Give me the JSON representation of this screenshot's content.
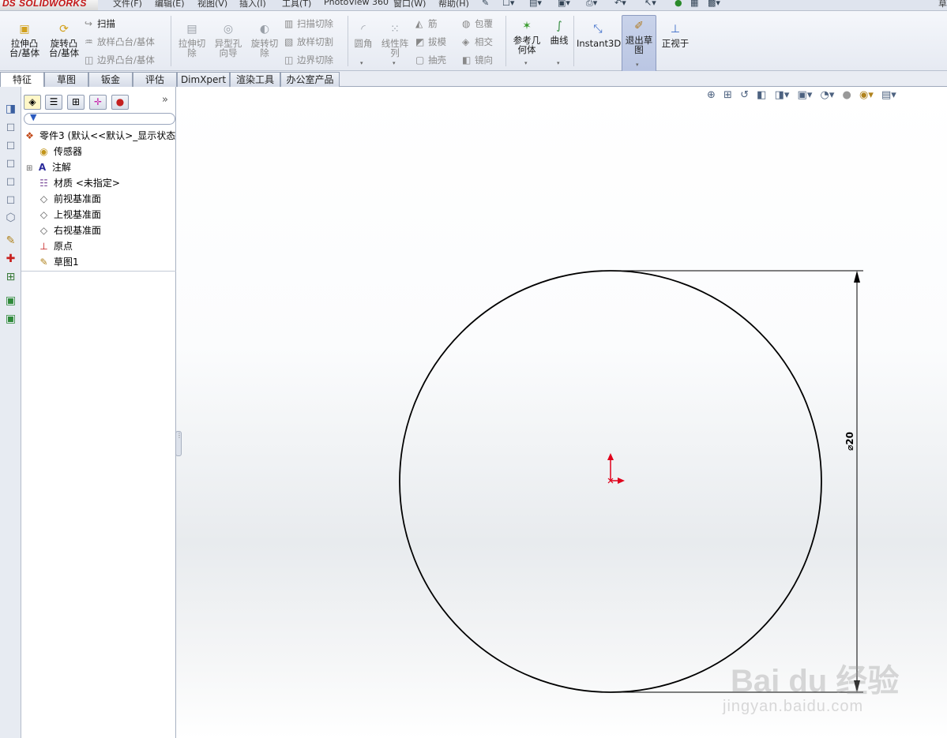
{
  "app": {
    "logo_ds": "DS",
    "logo_brand": "SOLIDWORKS"
  },
  "menu": [
    "文件(F)",
    "编辑(E)",
    "视图(V)",
    "插入(I)",
    "工具(T)",
    "PhotoView 360",
    "窗口(W)",
    "帮助(H)"
  ],
  "menu_edge_char": "草",
  "ribbon": {
    "extrude_boss": "拉伸凸\n台/基体",
    "revolve_boss": "旋转凸\n台/基体",
    "sweep": "扫描",
    "loft_boss": "放样凸台/基体",
    "boundary_boss": "边界凸台/基体",
    "extrude_cut": "拉伸切\n除",
    "hole_wizard": "异型孔\n向导",
    "revolve_cut": "旋转切\n除",
    "swept_cut": "扫描切除",
    "lofted_cut": "放样切割",
    "boundary_cut": "边界切除",
    "fillet": "圆角",
    "linear_pattern": "线性阵\n列",
    "rib": "筋",
    "draft": "拔模",
    "shell": "抽壳",
    "wrap": "包覆",
    "intersect": "相交",
    "mirror": "镜向",
    "ref_geometry": "参考几\n何体",
    "curves": "曲线",
    "instant3d": "Instant3D",
    "exit_sketch": "退出草\n图",
    "normal_to": "正视于"
  },
  "tabs": [
    "特征",
    "草图",
    "钣金",
    "评估",
    "DimXpert",
    "渲染工具",
    "办公室产品"
  ],
  "active_tab": "特征",
  "tree": {
    "root": "零件3  (默认<<默认>_显示状态",
    "items": [
      "传感器",
      "注解",
      "材质 <未指定>",
      "前视基准面",
      "上视基准面",
      "右视基准面",
      "原点",
      "草图1"
    ]
  },
  "fm_more": "»",
  "sketch": {
    "dimension_label": "⌀20",
    "diameter_value": 20,
    "origin_color": "#e0001b",
    "line_color": "#000000"
  },
  "watermark": {
    "brand": "Bai du 经验",
    "url": "jingyan.baidu.com"
  },
  "colors": {
    "ribbon_bg": "#eef1f7",
    "selected_button": "#c3cde6",
    "tab_border": "#97a2b5"
  }
}
